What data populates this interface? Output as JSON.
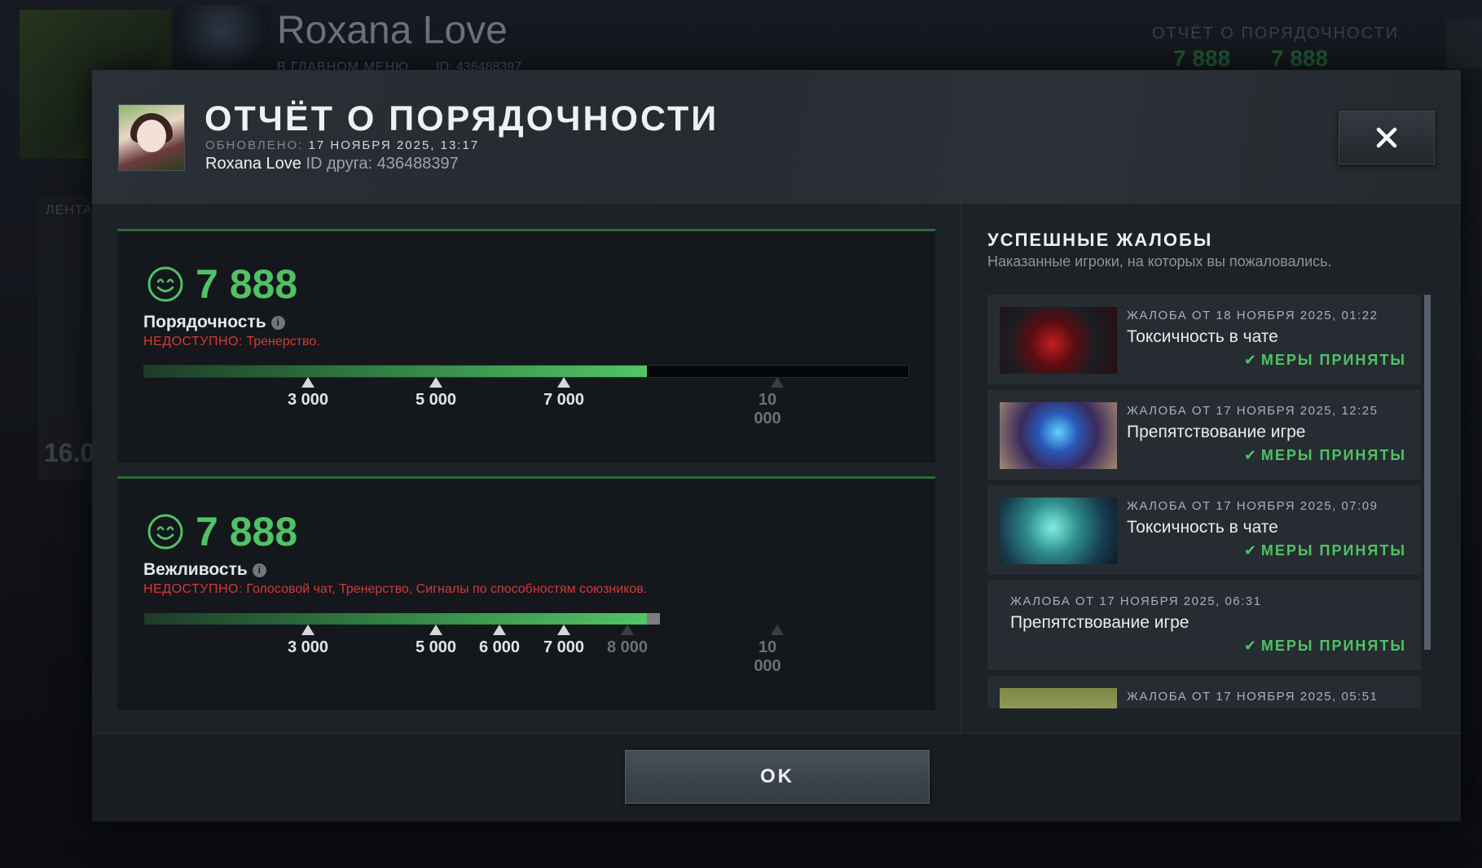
{
  "background": {
    "player_name": "Roxana Love",
    "status": "В ГЛАВНОМ МЕНЮ",
    "id_text": "ID: 436488397",
    "report_label": "ОТЧЁТ О ПОРЯДОЧНОСТИ",
    "score_a": "7 888",
    "score_b": "7 888",
    "feed_label": "ЛЕНТА",
    "side_number": "16.0"
  },
  "header": {
    "title": "ОТЧЁТ О ПОРЯДОЧНОСТИ",
    "updated_label": "ОБНОВЛЕНО:",
    "updated_value": "17 НОЯБРЯ 2025, 13:17",
    "player_name": "Roxana Love",
    "friend_id_label": "ID друга:",
    "friend_id": "436488397",
    "close_icon": "close-icon"
  },
  "colors": {
    "accent_green": "#4fc265",
    "warning_red": "#d23a3a"
  },
  "conduct": {
    "score": "7 888",
    "label": "Порядочность",
    "unavailable_label": "НЕДОСТУПНО:",
    "unavailable_value": "Тренерство.",
    "value": 7888,
    "max": 12000,
    "ticks": [
      "3 000",
      "5 000",
      "7 000",
      "10 000"
    ]
  },
  "behavior": {
    "score": "7 888",
    "label": "Вежливость",
    "unavailable_label": "НЕДОСТУПНО:",
    "unavailable_value": "Голосовой чат, Тренерство, Сигналы по способностям союзников.",
    "value": 7888,
    "threshold": 8000,
    "max": 12000,
    "ticks": [
      "3 000",
      "5 000",
      "6 000",
      "7 000",
      "8 000",
      "10 000"
    ]
  },
  "reports": {
    "title": "УСПЕШНЫЕ ЖАЛОБЫ",
    "subtitle": "Наказанные игроки, на которых вы пожаловались.",
    "items": [
      {
        "date": "ЖАЛОБА ОТ 18 НОЯБРЯ 2025, 01:22",
        "type": "Токсичность в чате",
        "status": "МЕРЫ ПРИНЯТЫ"
      },
      {
        "date": "ЖАЛОБА ОТ 17 НОЯБРЯ 2025, 12:25",
        "type": "Препятствование игре",
        "status": "МЕРЫ ПРИНЯТЫ"
      },
      {
        "date": "ЖАЛОБА ОТ 17 НОЯБРЯ 2025, 07:09",
        "type": "Токсичность в чате",
        "status": "МЕРЫ ПРИНЯТЫ"
      },
      {
        "date": "ЖАЛОБА ОТ 17 НОЯБРЯ 2025, 06:31",
        "type": "Препятствование игре",
        "status": "МЕРЫ ПРИНЯТЫ"
      },
      {
        "date": "ЖАЛОБА ОТ 17 НОЯБРЯ 2025, 05:51"
      }
    ]
  },
  "footer": {
    "ok_label": "OK"
  }
}
